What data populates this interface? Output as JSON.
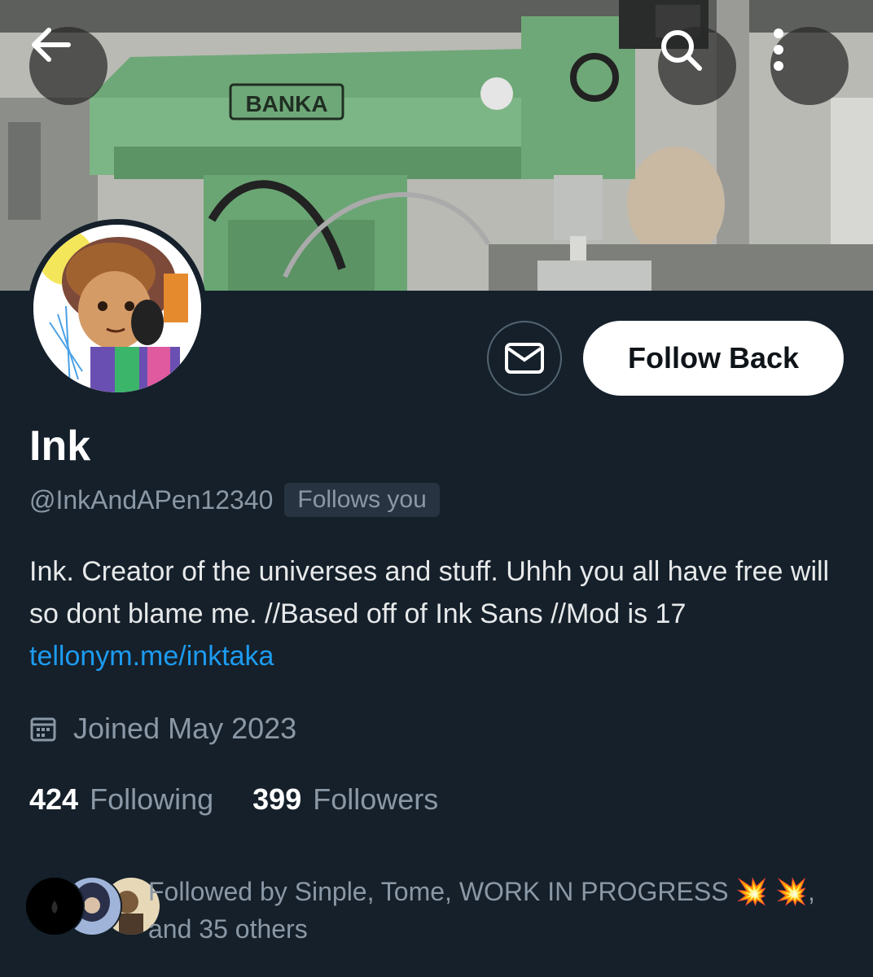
{
  "header": {
    "back_icon": "arrow-left-icon",
    "search_icon": "search-icon",
    "more_icon": "more-vertical-icon",
    "banner_machine_label": "BANKA"
  },
  "profile": {
    "display_name": "Ink",
    "handle": "@InkAndAPen12340",
    "follows_you_badge": "Follows you",
    "bio_text": "Ink. Creator of the universes and stuff. Uhhh you all have free will so dont blame me.  //Based off of Ink Sans  //Mod is 17 ",
    "bio_link": "tellonym.me/inktaka",
    "joined": "Joined May 2023",
    "joined_icon": "calendar-icon"
  },
  "actions": {
    "message_icon": "envelope-icon",
    "follow_label": "Follow Back"
  },
  "stats": {
    "following_count": "424",
    "following_label": "Following",
    "followers_count": "399",
    "followers_label": "Followers"
  },
  "followed_by": {
    "text": "Followed by Sinple, Tome, WORK IN PROGRESS 💥 💥, and 35 others"
  },
  "colors": {
    "background": "#15202b",
    "link": "#1d9bf0",
    "secondary_text": "#8b98a5",
    "follow_button_bg": "#ffffff"
  }
}
